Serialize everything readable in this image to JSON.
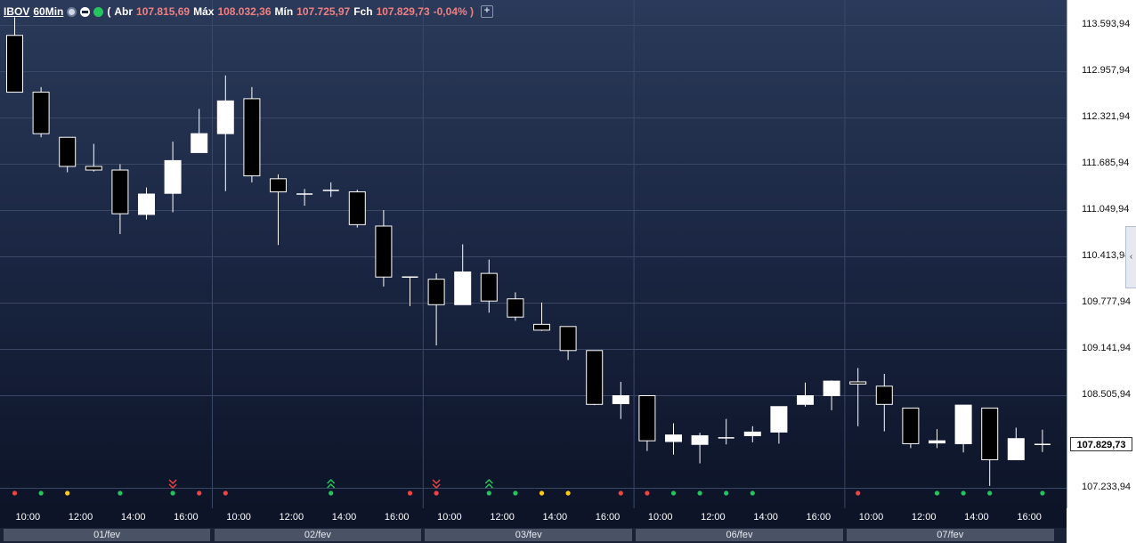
{
  "header": {
    "symbol": "IBOV",
    "timeframe": "60Min",
    "open_label": "Abr",
    "open_value": "107.815,69",
    "high_label": "Máx",
    "high_value": "108.032,36",
    "low_label": "Mín",
    "low_value": "107.725,97",
    "close_label": "Fch",
    "close_value": "107.829,73",
    "change_value": "-0,04%",
    "add_label": "+"
  },
  "chart_data": {
    "type": "candlestick",
    "ylim": [
      107100,
      113850
    ],
    "y_ticks": [
      "113.593,94",
      "112.957,94",
      "112.321,94",
      "111.685,94",
      "111.049,94",
      "110.413,94",
      "109.777,94",
      "109.141,94",
      "108.505,94",
      "107.233,94"
    ],
    "y_tick_values": [
      113593.94,
      112957.94,
      112321.94,
      111685.94,
      111049.94,
      110413.94,
      109777.94,
      109141.94,
      108505.94,
      107233.94
    ],
    "last_price": "107.829,73",
    "last_price_value": 107829.73,
    "x_ticks": [
      "10:00",
      "12:00",
      "14:00",
      "16:00",
      "10:00",
      "12:00",
      "14:00",
      "16:00",
      "10:00",
      "12:00",
      "14:00",
      "16:00",
      "10:00",
      "12:00",
      "14:00",
      "16:00",
      "10:00",
      "12:00",
      "14:00",
      "16:00"
    ],
    "x_tick_index": [
      1,
      3,
      5,
      7,
      9,
      11,
      13,
      15,
      17,
      19,
      21,
      23,
      25,
      27,
      29,
      31,
      33,
      35,
      37,
      39
    ],
    "days": [
      "01/fev",
      "02/fev",
      "03/fev",
      "06/fev",
      "07/fev"
    ],
    "day_bounds": [
      [
        0,
        8
      ],
      [
        8,
        16
      ],
      [
        16,
        24
      ],
      [
        24,
        32
      ],
      [
        32,
        40
      ]
    ],
    "candles": [
      {
        "o": 113450,
        "h": 113700,
        "l": 112670,
        "c": 112670
      },
      {
        "o": 112670,
        "h": 112740,
        "l": 112050,
        "c": 112100
      },
      {
        "o": 112050,
        "h": 112050,
        "l": 111570,
        "c": 111650
      },
      {
        "o": 111650,
        "h": 111960,
        "l": 111580,
        "c": 111600
      },
      {
        "o": 111600,
        "h": 111680,
        "l": 110720,
        "c": 111000
      },
      {
        "o": 110990,
        "h": 111360,
        "l": 110920,
        "c": 111270
      },
      {
        "o": 111280,
        "h": 111990,
        "l": 111020,
        "c": 111730
      },
      {
        "o": 111840,
        "h": 112440,
        "l": 111840,
        "c": 112100
      },
      {
        "o": 112100,
        "h": 112900,
        "l": 111310,
        "c": 112550
      },
      {
        "o": 112580,
        "h": 112740,
        "l": 111430,
        "c": 111520
      },
      {
        "o": 111480,
        "h": 111540,
        "l": 110570,
        "c": 111300
      },
      {
        "o": 111270,
        "h": 111340,
        "l": 111110,
        "c": 111270
      },
      {
        "o": 111320,
        "h": 111430,
        "l": 111230,
        "c": 111320
      },
      {
        "o": 111300,
        "h": 111330,
        "l": 110810,
        "c": 110850
      },
      {
        "o": 110830,
        "h": 111050,
        "l": 110000,
        "c": 110130
      },
      {
        "o": 110130,
        "h": 110130,
        "l": 109730,
        "c": 110130
      },
      {
        "o": 110100,
        "h": 110180,
        "l": 109190,
        "c": 109750
      },
      {
        "o": 109750,
        "h": 110580,
        "l": 109750,
        "c": 110200
      },
      {
        "o": 110180,
        "h": 110370,
        "l": 109640,
        "c": 109800
      },
      {
        "o": 109830,
        "h": 109920,
        "l": 109530,
        "c": 109580
      },
      {
        "o": 109480,
        "h": 109780,
        "l": 109390,
        "c": 109400
      },
      {
        "o": 109450,
        "h": 109450,
        "l": 108990,
        "c": 109120
      },
      {
        "o": 109120,
        "h": 109120,
        "l": 108370,
        "c": 108380
      },
      {
        "o": 108390,
        "h": 108690,
        "l": 108180,
        "c": 108500
      },
      {
        "o": 108500,
        "h": 108500,
        "l": 107740,
        "c": 107880
      },
      {
        "o": 107870,
        "h": 108120,
        "l": 107690,
        "c": 107960
      },
      {
        "o": 107830,
        "h": 107990,
        "l": 107570,
        "c": 107950
      },
      {
        "o": 107910,
        "h": 108180,
        "l": 107830,
        "c": 107920
      },
      {
        "o": 107950,
        "h": 108080,
        "l": 107860,
        "c": 108000
      },
      {
        "o": 108000,
        "h": 108350,
        "l": 107840,
        "c": 108350
      },
      {
        "o": 108380,
        "h": 108680,
        "l": 108350,
        "c": 108500
      },
      {
        "o": 108500,
        "h": 108710,
        "l": 108300,
        "c": 108700
      },
      {
        "o": 108690,
        "h": 108880,
        "l": 108080,
        "c": 108660
      },
      {
        "o": 108630,
        "h": 108800,
        "l": 108010,
        "c": 108380
      },
      {
        "o": 108330,
        "h": 108330,
        "l": 107780,
        "c": 107840
      },
      {
        "o": 107850,
        "h": 108040,
        "l": 107780,
        "c": 107880
      },
      {
        "o": 107840,
        "h": 108350,
        "l": 107720,
        "c": 108370
      },
      {
        "o": 108330,
        "h": 108330,
        "l": 107260,
        "c": 107620
      },
      {
        "o": 107620,
        "h": 108060,
        "l": 107620,
        "c": 107910
      },
      {
        "o": 107815.69,
        "h": 108032.36,
        "l": 107725.97,
        "c": 107829.73
      }
    ],
    "signal_dots": [
      {
        "i": 0,
        "color": "#ef4444"
      },
      {
        "i": 1,
        "color": "#22c55e"
      },
      {
        "i": 2,
        "color": "#facc15"
      },
      {
        "i": 4,
        "color": "#22c55e"
      },
      {
        "i": 6,
        "color": "#22c55e"
      },
      {
        "i": 7,
        "color": "#ef4444"
      },
      {
        "i": 8,
        "color": "#ef4444"
      },
      {
        "i": 12,
        "color": "#22c55e"
      },
      {
        "i": 15,
        "color": "#ef4444"
      },
      {
        "i": 16,
        "color": "#ef4444"
      },
      {
        "i": 18,
        "color": "#22c55e"
      },
      {
        "i": 19,
        "color": "#22c55e"
      },
      {
        "i": 20,
        "color": "#facc15"
      },
      {
        "i": 21,
        "color": "#facc15"
      },
      {
        "i": 23,
        "color": "#ef4444"
      },
      {
        "i": 24,
        "color": "#ef4444"
      },
      {
        "i": 25,
        "color": "#22c55e"
      },
      {
        "i": 26,
        "color": "#22c55e"
      },
      {
        "i": 27,
        "color": "#22c55e"
      },
      {
        "i": 28,
        "color": "#22c55e"
      },
      {
        "i": 32,
        "color": "#ef4444"
      },
      {
        "i": 35,
        "color": "#22c55e"
      },
      {
        "i": 36,
        "color": "#22c55e"
      },
      {
        "i": 37,
        "color": "#22c55e"
      },
      {
        "i": 39,
        "color": "#22c55e"
      }
    ],
    "signal_arrows": [
      {
        "i": 6,
        "dir": "down",
        "color": "#ef4444"
      },
      {
        "i": 12,
        "dir": "up",
        "color": "#22c55e"
      },
      {
        "i": 16,
        "dir": "down",
        "color": "#ef4444"
      },
      {
        "i": 18,
        "dir": "up",
        "color": "#22c55e"
      }
    ],
    "colors": {
      "up": "#ffffff",
      "down": "#000000",
      "outline": "#ffffff",
      "wick": "#ffffff"
    },
    "grid": true
  }
}
